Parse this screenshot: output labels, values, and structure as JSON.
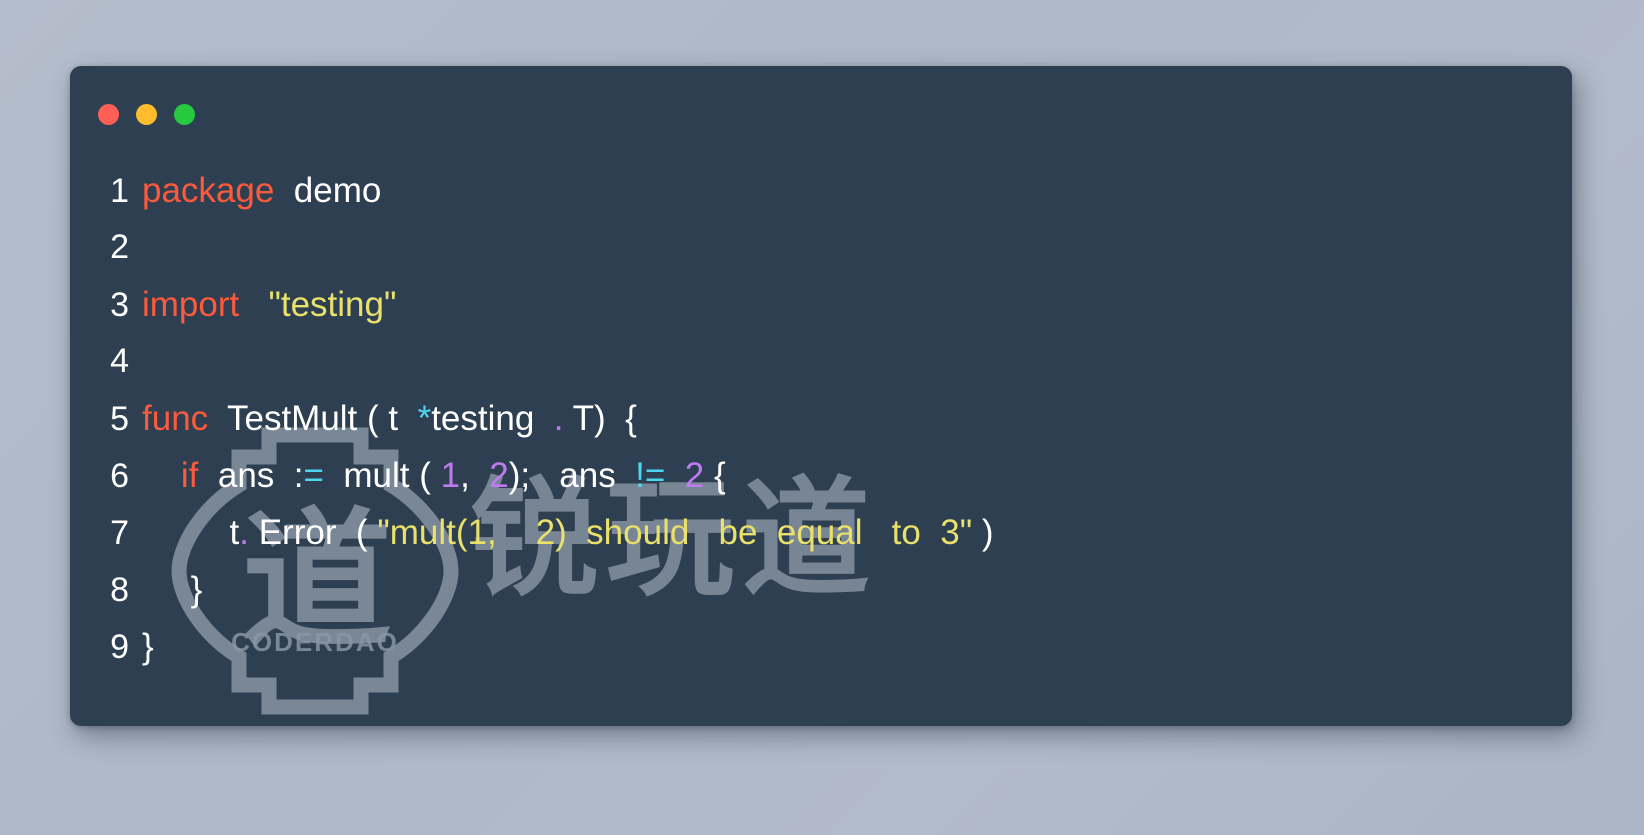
{
  "window": {
    "title_bar": {
      "buttons": [
        {
          "name": "close",
          "color": "#ff5f56"
        },
        {
          "name": "minimize",
          "color": "#ffbd2e"
        },
        {
          "name": "maximize",
          "color": "#27c93f"
        }
      ]
    },
    "background_color": "#2e3f51",
    "page_background_color": "#b0bac9"
  },
  "watermark": {
    "logo_character": "道",
    "logo_label": "CODERDAO",
    "text": "锐玩道",
    "color": "#8b97a6"
  },
  "editor": {
    "language": "go",
    "theme_colors": {
      "keyword": "#fb5a3c",
      "string": "#e9e16c",
      "number": "#c07af0",
      "operator": "#4fd6ef",
      "plain": "#ffffff",
      "punctuation": "#c07af0"
    },
    "lines": [
      {
        "number": "1",
        "tokens": [
          {
            "t": "package",
            "c": "kw"
          },
          {
            "t": "  demo",
            "c": "pl"
          }
        ]
      },
      {
        "number": "2",
        "tokens": []
      },
      {
        "number": "3",
        "tokens": [
          {
            "t": "import",
            "c": "kw"
          },
          {
            "t": "   ",
            "c": "pl"
          },
          {
            "t": "\"testing\"",
            "c": "str"
          }
        ]
      },
      {
        "number": "4",
        "tokens": []
      },
      {
        "number": "5",
        "tokens": [
          {
            "t": "func",
            "c": "kw"
          },
          {
            "t": "  TestMult ( t  ",
            "c": "pl"
          },
          {
            "t": "*",
            "c": "op"
          },
          {
            "t": "testing",
            "c": "pl"
          },
          {
            "t": "  .",
            "c": "pt"
          },
          {
            "t": " T)  {",
            "c": "pl"
          }
        ]
      },
      {
        "number": "6",
        "tokens": [
          {
            "t": "    ",
            "c": "pl"
          },
          {
            "t": "if",
            "c": "kw"
          },
          {
            "t": "  ans  :",
            "c": "pl"
          },
          {
            "t": "=",
            "c": "op"
          },
          {
            "t": "  mult ( ",
            "c": "pl"
          },
          {
            "t": "1",
            "c": "num"
          },
          {
            "t": ", ",
            "c": "pl"
          },
          {
            "t": " 2",
            "c": "num"
          },
          {
            "t": ");   ans  ",
            "c": "pl"
          },
          {
            "t": "!=",
            "c": "op"
          },
          {
            "t": "  ",
            "c": "pl"
          },
          {
            "t": "2",
            "c": "num"
          },
          {
            "t": " {",
            "c": "pl"
          }
        ]
      },
      {
        "number": "7",
        "tokens": [
          {
            "t": "         t",
            "c": "pl"
          },
          {
            "t": ".",
            "c": "pt"
          },
          {
            "t": " Error  ( ",
            "c": "pl"
          },
          {
            "t": "\"mult(1,    2)  should   be  equal   to  3\"",
            "c": "str"
          },
          {
            "t": " )",
            "c": "pl"
          }
        ]
      },
      {
        "number": "8",
        "tokens": [
          {
            "t": "     }",
            "c": "pl"
          }
        ]
      },
      {
        "number": "9",
        "tokens": [
          {
            "t": "}",
            "c": "pl"
          }
        ]
      }
    ]
  }
}
